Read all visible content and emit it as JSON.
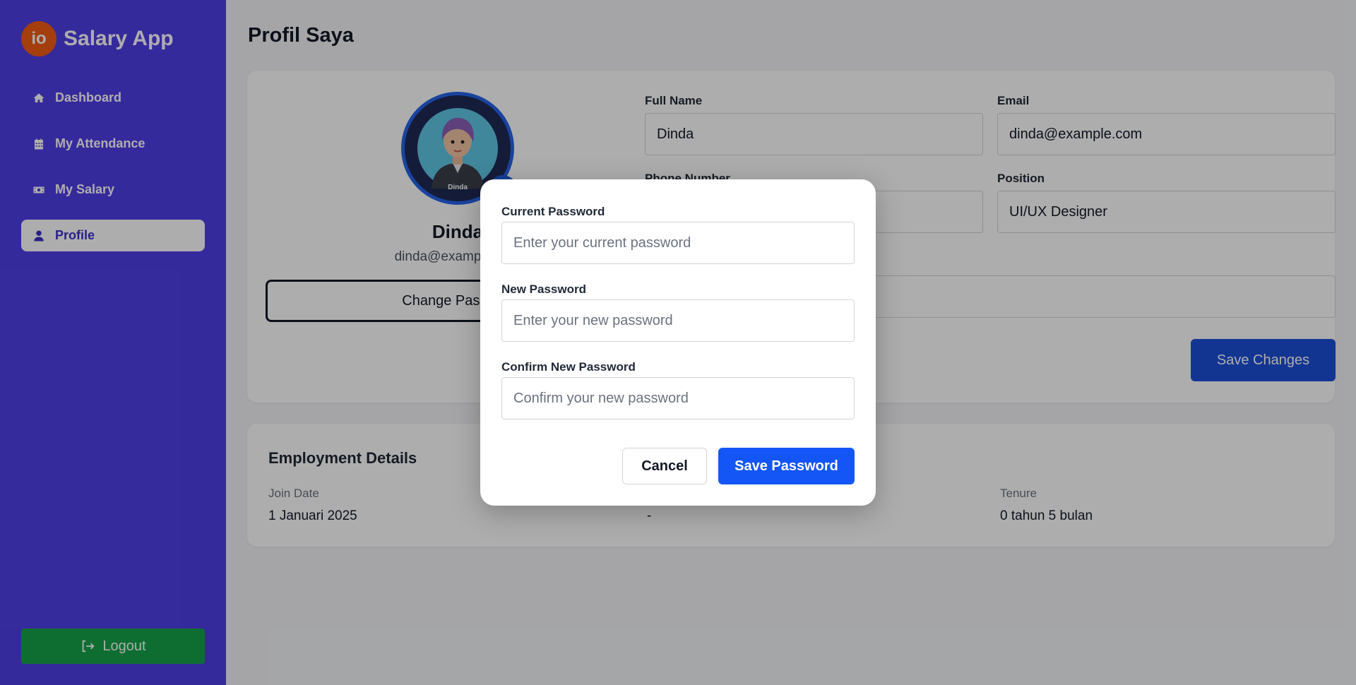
{
  "brand": {
    "logo_text": "io",
    "title": "Salary App"
  },
  "sidebar": {
    "items": [
      {
        "label": "Dashboard",
        "icon": "home-icon",
        "active": false
      },
      {
        "label": "My Attendance",
        "icon": "calendar-icon",
        "active": false
      },
      {
        "label": "My Salary",
        "icon": "money-icon",
        "active": false
      },
      {
        "label": "Profile",
        "icon": "user-icon",
        "active": true
      }
    ],
    "logout_label": "Logout"
  },
  "page": {
    "title": "Profil Saya"
  },
  "profile": {
    "avatar_tag": "Dinda",
    "name": "Dinda",
    "email": "dinda@example.com",
    "change_password_label": "Change Password",
    "fields": {
      "full_name": {
        "label": "Full Name",
        "value": "Dinda"
      },
      "email": {
        "label": "Email",
        "value": "dinda@example.com"
      },
      "phone": {
        "label": "Phone Number",
        "value": ""
      },
      "position": {
        "label": "Position",
        "value": "UI/UX Designer"
      },
      "address": {
        "label": "",
        "value": ""
      }
    },
    "save_changes_label": "Save Changes"
  },
  "employment": {
    "title": "Employment Details",
    "join_date": {
      "label": "Join Date",
      "value": "1 Januari 2025"
    },
    "middle": {
      "label": "",
      "value": "-"
    },
    "tenure": {
      "label": "Tenure",
      "value": "0 tahun 5 bulan"
    }
  },
  "modal": {
    "current_password": {
      "label": "Current Password",
      "placeholder": "Enter your current password"
    },
    "new_password": {
      "label": "New Password",
      "placeholder": "Enter your new password"
    },
    "confirm_password": {
      "label": "Confirm New Password",
      "placeholder": "Confirm your new password"
    },
    "cancel_label": "Cancel",
    "save_label": "Save Password"
  },
  "colors": {
    "sidebar_bg": "#4f3fe6",
    "logo_bg": "#f25c12",
    "primary": "#1456f5",
    "logout_bg": "#16a34a"
  }
}
